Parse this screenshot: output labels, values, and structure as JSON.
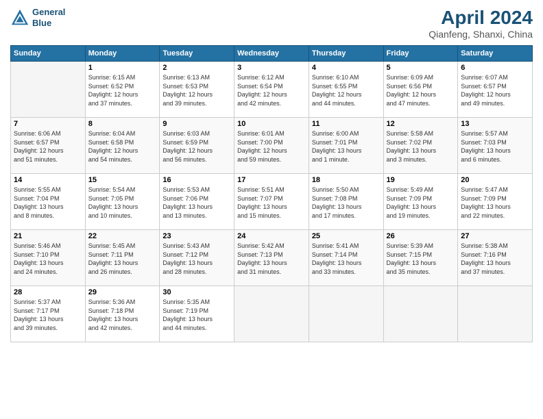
{
  "header": {
    "logo_line1": "General",
    "logo_line2": "Blue",
    "title": "April 2024",
    "location": "Qianfeng, Shanxi, China"
  },
  "weekdays": [
    "Sunday",
    "Monday",
    "Tuesday",
    "Wednesday",
    "Thursday",
    "Friday",
    "Saturday"
  ],
  "weeks": [
    [
      {
        "day": "",
        "info": ""
      },
      {
        "day": "1",
        "info": "Sunrise: 6:15 AM\nSunset: 6:52 PM\nDaylight: 12 hours\nand 37 minutes."
      },
      {
        "day": "2",
        "info": "Sunrise: 6:13 AM\nSunset: 6:53 PM\nDaylight: 12 hours\nand 39 minutes."
      },
      {
        "day": "3",
        "info": "Sunrise: 6:12 AM\nSunset: 6:54 PM\nDaylight: 12 hours\nand 42 minutes."
      },
      {
        "day": "4",
        "info": "Sunrise: 6:10 AM\nSunset: 6:55 PM\nDaylight: 12 hours\nand 44 minutes."
      },
      {
        "day": "5",
        "info": "Sunrise: 6:09 AM\nSunset: 6:56 PM\nDaylight: 12 hours\nand 47 minutes."
      },
      {
        "day": "6",
        "info": "Sunrise: 6:07 AM\nSunset: 6:57 PM\nDaylight: 12 hours\nand 49 minutes."
      }
    ],
    [
      {
        "day": "7",
        "info": "Sunrise: 6:06 AM\nSunset: 6:57 PM\nDaylight: 12 hours\nand 51 minutes."
      },
      {
        "day": "8",
        "info": "Sunrise: 6:04 AM\nSunset: 6:58 PM\nDaylight: 12 hours\nand 54 minutes."
      },
      {
        "day": "9",
        "info": "Sunrise: 6:03 AM\nSunset: 6:59 PM\nDaylight: 12 hours\nand 56 minutes."
      },
      {
        "day": "10",
        "info": "Sunrise: 6:01 AM\nSunset: 7:00 PM\nDaylight: 12 hours\nand 59 minutes."
      },
      {
        "day": "11",
        "info": "Sunrise: 6:00 AM\nSunset: 7:01 PM\nDaylight: 13 hours\nand 1 minute."
      },
      {
        "day": "12",
        "info": "Sunrise: 5:58 AM\nSunset: 7:02 PM\nDaylight: 13 hours\nand 3 minutes."
      },
      {
        "day": "13",
        "info": "Sunrise: 5:57 AM\nSunset: 7:03 PM\nDaylight: 13 hours\nand 6 minutes."
      }
    ],
    [
      {
        "day": "14",
        "info": "Sunrise: 5:55 AM\nSunset: 7:04 PM\nDaylight: 13 hours\nand 8 minutes."
      },
      {
        "day": "15",
        "info": "Sunrise: 5:54 AM\nSunset: 7:05 PM\nDaylight: 13 hours\nand 10 minutes."
      },
      {
        "day": "16",
        "info": "Sunrise: 5:53 AM\nSunset: 7:06 PM\nDaylight: 13 hours\nand 13 minutes."
      },
      {
        "day": "17",
        "info": "Sunrise: 5:51 AM\nSunset: 7:07 PM\nDaylight: 13 hours\nand 15 minutes."
      },
      {
        "day": "18",
        "info": "Sunrise: 5:50 AM\nSunset: 7:08 PM\nDaylight: 13 hours\nand 17 minutes."
      },
      {
        "day": "19",
        "info": "Sunrise: 5:49 AM\nSunset: 7:09 PM\nDaylight: 13 hours\nand 19 minutes."
      },
      {
        "day": "20",
        "info": "Sunrise: 5:47 AM\nSunset: 7:09 PM\nDaylight: 13 hours\nand 22 minutes."
      }
    ],
    [
      {
        "day": "21",
        "info": "Sunrise: 5:46 AM\nSunset: 7:10 PM\nDaylight: 13 hours\nand 24 minutes."
      },
      {
        "day": "22",
        "info": "Sunrise: 5:45 AM\nSunset: 7:11 PM\nDaylight: 13 hours\nand 26 minutes."
      },
      {
        "day": "23",
        "info": "Sunrise: 5:43 AM\nSunset: 7:12 PM\nDaylight: 13 hours\nand 28 minutes."
      },
      {
        "day": "24",
        "info": "Sunrise: 5:42 AM\nSunset: 7:13 PM\nDaylight: 13 hours\nand 31 minutes."
      },
      {
        "day": "25",
        "info": "Sunrise: 5:41 AM\nSunset: 7:14 PM\nDaylight: 13 hours\nand 33 minutes."
      },
      {
        "day": "26",
        "info": "Sunrise: 5:39 AM\nSunset: 7:15 PM\nDaylight: 13 hours\nand 35 minutes."
      },
      {
        "day": "27",
        "info": "Sunrise: 5:38 AM\nSunset: 7:16 PM\nDaylight: 13 hours\nand 37 minutes."
      }
    ],
    [
      {
        "day": "28",
        "info": "Sunrise: 5:37 AM\nSunset: 7:17 PM\nDaylight: 13 hours\nand 39 minutes."
      },
      {
        "day": "29",
        "info": "Sunrise: 5:36 AM\nSunset: 7:18 PM\nDaylight: 13 hours\nand 42 minutes."
      },
      {
        "day": "30",
        "info": "Sunrise: 5:35 AM\nSunset: 7:19 PM\nDaylight: 13 hours\nand 44 minutes."
      },
      {
        "day": "",
        "info": ""
      },
      {
        "day": "",
        "info": ""
      },
      {
        "day": "",
        "info": ""
      },
      {
        "day": "",
        "info": ""
      }
    ]
  ]
}
